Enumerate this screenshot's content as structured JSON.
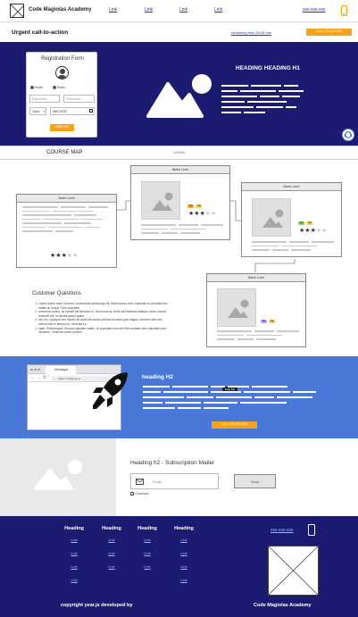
{
  "header": {
    "brand": "Code Magiolas Academy",
    "links": [
      "Link",
      "Link",
      "Link",
      "Link"
    ],
    "phone": "555-555-555"
  },
  "cta_bar": {
    "title": "Urgent call-to-action",
    "timer": "remaining time 59:35 min",
    "button": "CALL-TO-ACTION"
  },
  "registration": {
    "title": "Registration Form",
    "radio_1": "Radio",
    "radio_2": "Radio",
    "field_1_placeholder": "Placeholder",
    "field_2_placeholder": "Placeholder",
    "select_value": "10pax",
    "date_value": "08/07/2020",
    "submit": "SIGN UP"
  },
  "hero": {
    "heading": "HEADING HEADING H1"
  },
  "course_bar": {
    "title": "COURSE MAP",
    "size": "1440x40"
  },
  "course_map": {
    "cards": [
      {
        "head": "Barim Lorm",
        "rating": 3,
        "max": 5
      },
      {
        "head": "Barim Lorm",
        "rating": 3,
        "max": 5,
        "tags": [
          "Tag",
          "Tag"
        ]
      },
      {
        "head": "Barim Lorm",
        "rating": 3,
        "max": 5,
        "tags": [
          "Tag",
          "Tag"
        ]
      },
      {
        "head": "Barim Lorm",
        "tags": [
          "Tag",
          "Tag"
        ]
      }
    ]
  },
  "questions": {
    "title": "Customer Questions",
    "items": [
      "Lorem ipsum dolor sit amet, consectetur adipiscing elit. Nulla auctor velit, vulputate eu pharetra nec, mattis ac neque. Duis vulputate.",
      "commodo lectus, ac blandit elit tincidunt id. Sed rhoncus, tortor sed eleifend tristique, tortor mauris molestie elit, et lacinia ipsum quam.",
      "nec dui. Quisque nec mauris sit amet elit iaculis pretium sit amet quis magna. Aenean velit odio, elementum in tempus ut, vehicula eu.",
      "diam. Pellentesque rhoncus aliquam mattis. Ut vulputate eros sed felis sodales nec vulputate justo hendrerit. Vivamus varius pretium."
    ]
  },
  "blue_section": {
    "browser_tab": "Mindapps",
    "browser_url": "https://mindapps.io",
    "heading": "heading H2",
    "badge": "Help Me",
    "button": "CALL-TO-ACTION"
  },
  "subscription": {
    "heading": "Heading h2 - Subscription Mailer",
    "email_placeholder": "Email",
    "send": "Send",
    "checkbox": "Checkbox"
  },
  "footer": {
    "columns": [
      {
        "heading": "Heading",
        "links": [
          "Link",
          "Link",
          "Link",
          "Link"
        ]
      },
      {
        "heading": "Heading",
        "links": [
          "Link",
          "Link",
          "Link"
        ]
      },
      {
        "heading": "Heading",
        "links": [
          "Link",
          "Link",
          "Link"
        ]
      },
      {
        "heading": "Heading",
        "links": [
          "Link",
          "Link",
          "Link",
          "Link"
        ]
      }
    ],
    "phone": "555-555-555",
    "copyright": "copyright year.js developed by",
    "brand": "Code Magiolas Academy"
  }
}
